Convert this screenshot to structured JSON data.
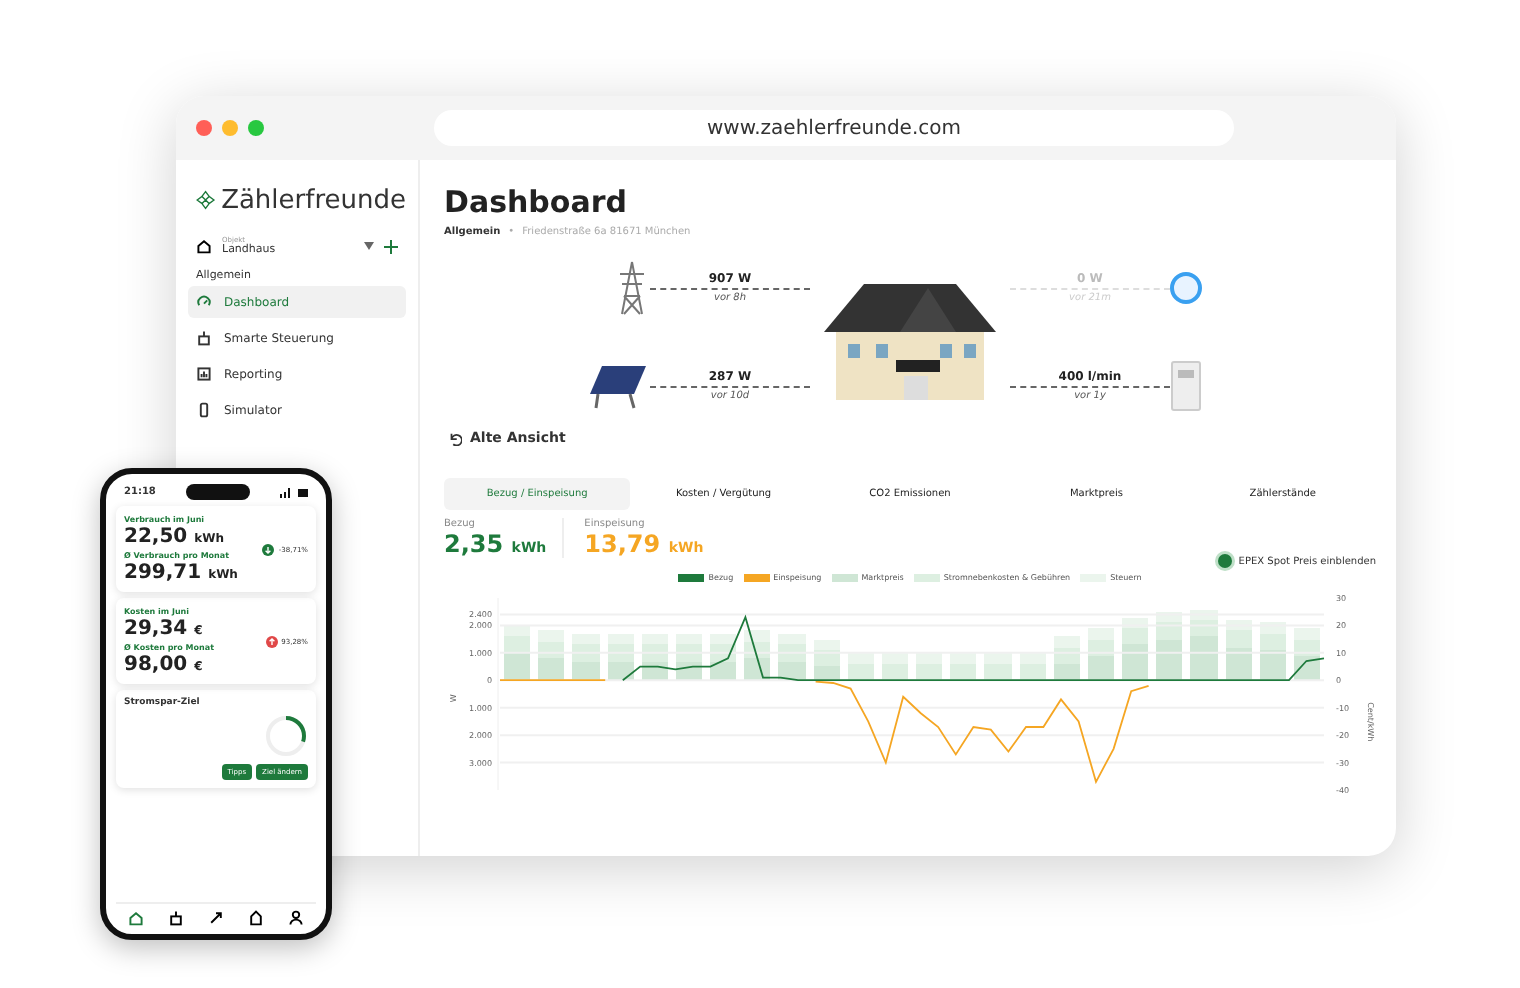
{
  "browser": {
    "url": "www.zaehlerfreunde.com"
  },
  "sidebar": {
    "logo": "Zählerfreunde",
    "object_label": "Objekt",
    "object_value": "Landhaus",
    "section": "Allgemein",
    "items": [
      {
        "label": "Dashboard",
        "selected": true
      },
      {
        "label": "Smarte Steuerung",
        "selected": false
      },
      {
        "label": "Reporting",
        "selected": false
      },
      {
        "label": "Simulator",
        "selected": false
      }
    ]
  },
  "header": {
    "title": "Dashboard",
    "breadcrumb": "Allgemein",
    "separator": "•",
    "address": "Friedenstraße 6a 81671 München"
  },
  "flows": [
    {
      "kind": "grid",
      "value": "907 W",
      "age": "vor 8h",
      "active": true
    },
    {
      "kind": "plug",
      "value": "0 W",
      "age": "vor 21m",
      "active": false
    },
    {
      "kind": "solar",
      "value": "287 W",
      "age": "vor 10d",
      "active": true
    },
    {
      "kind": "meter",
      "value": "400 l/min",
      "age": "vor 1y",
      "active": true
    }
  ],
  "old_view": "Alte Ansicht",
  "tabs": [
    {
      "label": "Bezug / Einspeisung",
      "selected": true
    },
    {
      "label": "Kosten / Vergütung",
      "selected": false
    },
    {
      "label": "CO2 Emissionen",
      "selected": false
    },
    {
      "label": "Marktpreis",
      "selected": false
    },
    {
      "label": "Zählerstände",
      "selected": false
    }
  ],
  "stats": [
    {
      "label": "Bezug",
      "value": "2,35",
      "unit": "kWh",
      "color": "#1e7a3c"
    },
    {
      "label": "Einspeisung",
      "value": "13,79",
      "unit": "kWh",
      "color": "#f5a623"
    }
  ],
  "toggle": {
    "label": "EPEX Spot Preis einblenden",
    "on": true
  },
  "price_legend": [
    {
      "name": "Marktpreis",
      "color": "#cfe6d5"
    },
    {
      "name": "Stromnebenkosten & Gebühren",
      "color": "#ddefe1"
    },
    {
      "name": "Steuern",
      "color": "#ebf5ed"
    }
  ],
  "right_axis": {
    "label": "Cent/kWh",
    "ticks": [
      "30",
      "20",
      "10",
      "0",
      "-10",
      "-20",
      "-30",
      "-40"
    ]
  },
  "chart_data": {
    "type": "line",
    "ylabel": "W",
    "ylim": [
      -4000,
      3000
    ],
    "grid": true,
    "yticks": [
      {
        "value": 2400,
        "label": "2.400"
      },
      {
        "value": 2000,
        "label": "2.000"
      },
      {
        "value": 1000,
        "label": "1.000"
      },
      0,
      {
        "value": -1000,
        "label": "1.000"
      },
      {
        "value": -2000,
        "label": "2.000"
      },
      {
        "value": -3000,
        "label": "3.000"
      }
    ],
    "series": [
      {
        "name": "Bezug",
        "color": "#1e7a3c",
        "values": [
          null,
          null,
          null,
          null,
          null,
          null,
          null,
          0,
          500,
          500,
          400,
          500,
          500,
          800,
          2300,
          100,
          100,
          0,
          0,
          0,
          0,
          0,
          0,
          0,
          0,
          0,
          0,
          0,
          0,
          0,
          0,
          0,
          0,
          0,
          0,
          0,
          0,
          0,
          0,
          0,
          0,
          0,
          0,
          0,
          0,
          0,
          700,
          800
        ]
      },
      {
        "name": "Einspeisung",
        "color": "#f5a623",
        "values": [
          0,
          0,
          0,
          0,
          0,
          0,
          0,
          null,
          null,
          null,
          null,
          null,
          null,
          null,
          null,
          null,
          null,
          null,
          -50,
          -100,
          -300,
          -1500,
          -3000,
          -600,
          -1200,
          -1700,
          -2700,
          -1700,
          -1800,
          -2600,
          -1700,
          -1700,
          -700,
          -1500,
          -3700,
          -2500,
          -400,
          -200,
          null,
          null,
          null,
          null,
          null,
          null,
          null,
          null,
          null,
          null
        ]
      }
    ]
  },
  "phone": {
    "time": "21:18",
    "cards": [
      {
        "title": "Verbrauch im Juni",
        "value": "22,50",
        "unit": "kWh",
        "avg_title": "Ø Verbrauch pro Monat",
        "avg_value": "299,71",
        "avg_unit": "kWh",
        "trend": "-38,71%",
        "kind": "down"
      },
      {
        "title": "Kosten im Juni",
        "value": "29,34",
        "unit": "€",
        "avg_title": "Ø Kosten pro Monat",
        "avg_value": "98,00",
        "avg_unit": "€",
        "trend": "93,28%",
        "kind": "up"
      }
    ],
    "goal": {
      "title": "Stromspar-Ziel",
      "level": 0.3,
      "buttons": [
        "Tipps",
        "Ziel ändern"
      ]
    }
  }
}
